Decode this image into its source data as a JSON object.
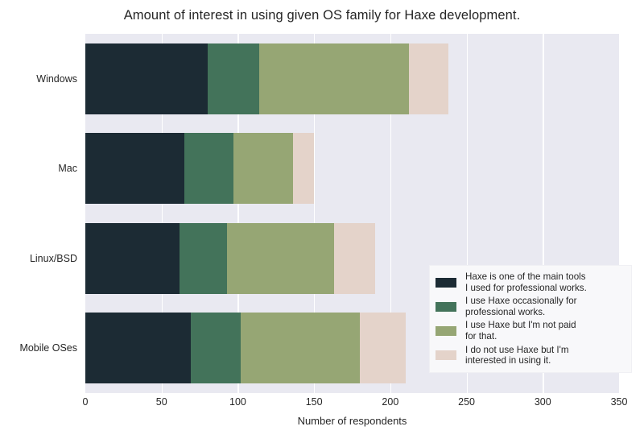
{
  "chart_data": {
    "type": "bar",
    "orientation": "horizontal",
    "stacked": true,
    "title": "Amount of interest in using given OS family for Haxe development.",
    "xlabel": "Number of respondents",
    "ylabel": "",
    "categories": [
      "Windows",
      "Mac",
      "Linux/BSD",
      "Mobile OSes"
    ],
    "xlim": [
      0,
      350
    ],
    "xticks": [
      0,
      50,
      100,
      150,
      200,
      250,
      300,
      350
    ],
    "xtick_labels": [
      "0",
      "50",
      "100",
      "150",
      "200",
      "250",
      "300",
      "350"
    ],
    "grid": true,
    "legend_position": "lower right",
    "series": [
      {
        "name": "Haxe is one of the main tools\nI used for professional works.",
        "color": "#1c2b34",
        "values": [
          80,
          65,
          62,
          69
        ]
      },
      {
        "name": "I use Haxe occasionally for\nprofessional works.",
        "color": "#43735a",
        "values": [
          34,
          32,
          31,
          33
        ]
      },
      {
        "name": "I use Haxe but I'm not paid\nfor that.",
        "color": "#96a674",
        "values": [
          98,
          39,
          70,
          78
        ]
      },
      {
        "name": "I do not use Haxe but I'm\ninterested in using it.",
        "color": "#e4d3ca",
        "values": [
          26,
          14,
          27,
          30
        ]
      }
    ],
    "totals": [
      238,
      150,
      190,
      210
    ],
    "cumulative": [
      [
        80,
        114,
        212,
        238
      ],
      [
        65,
        97,
        136,
        150
      ],
      [
        62,
        93,
        163,
        190
      ],
      [
        69,
        102,
        180,
        210
      ]
    ],
    "plot_background": "#e9e9f1",
    "gridline_color": "#ffffff",
    "legend_background": "#f8f8fa"
  }
}
